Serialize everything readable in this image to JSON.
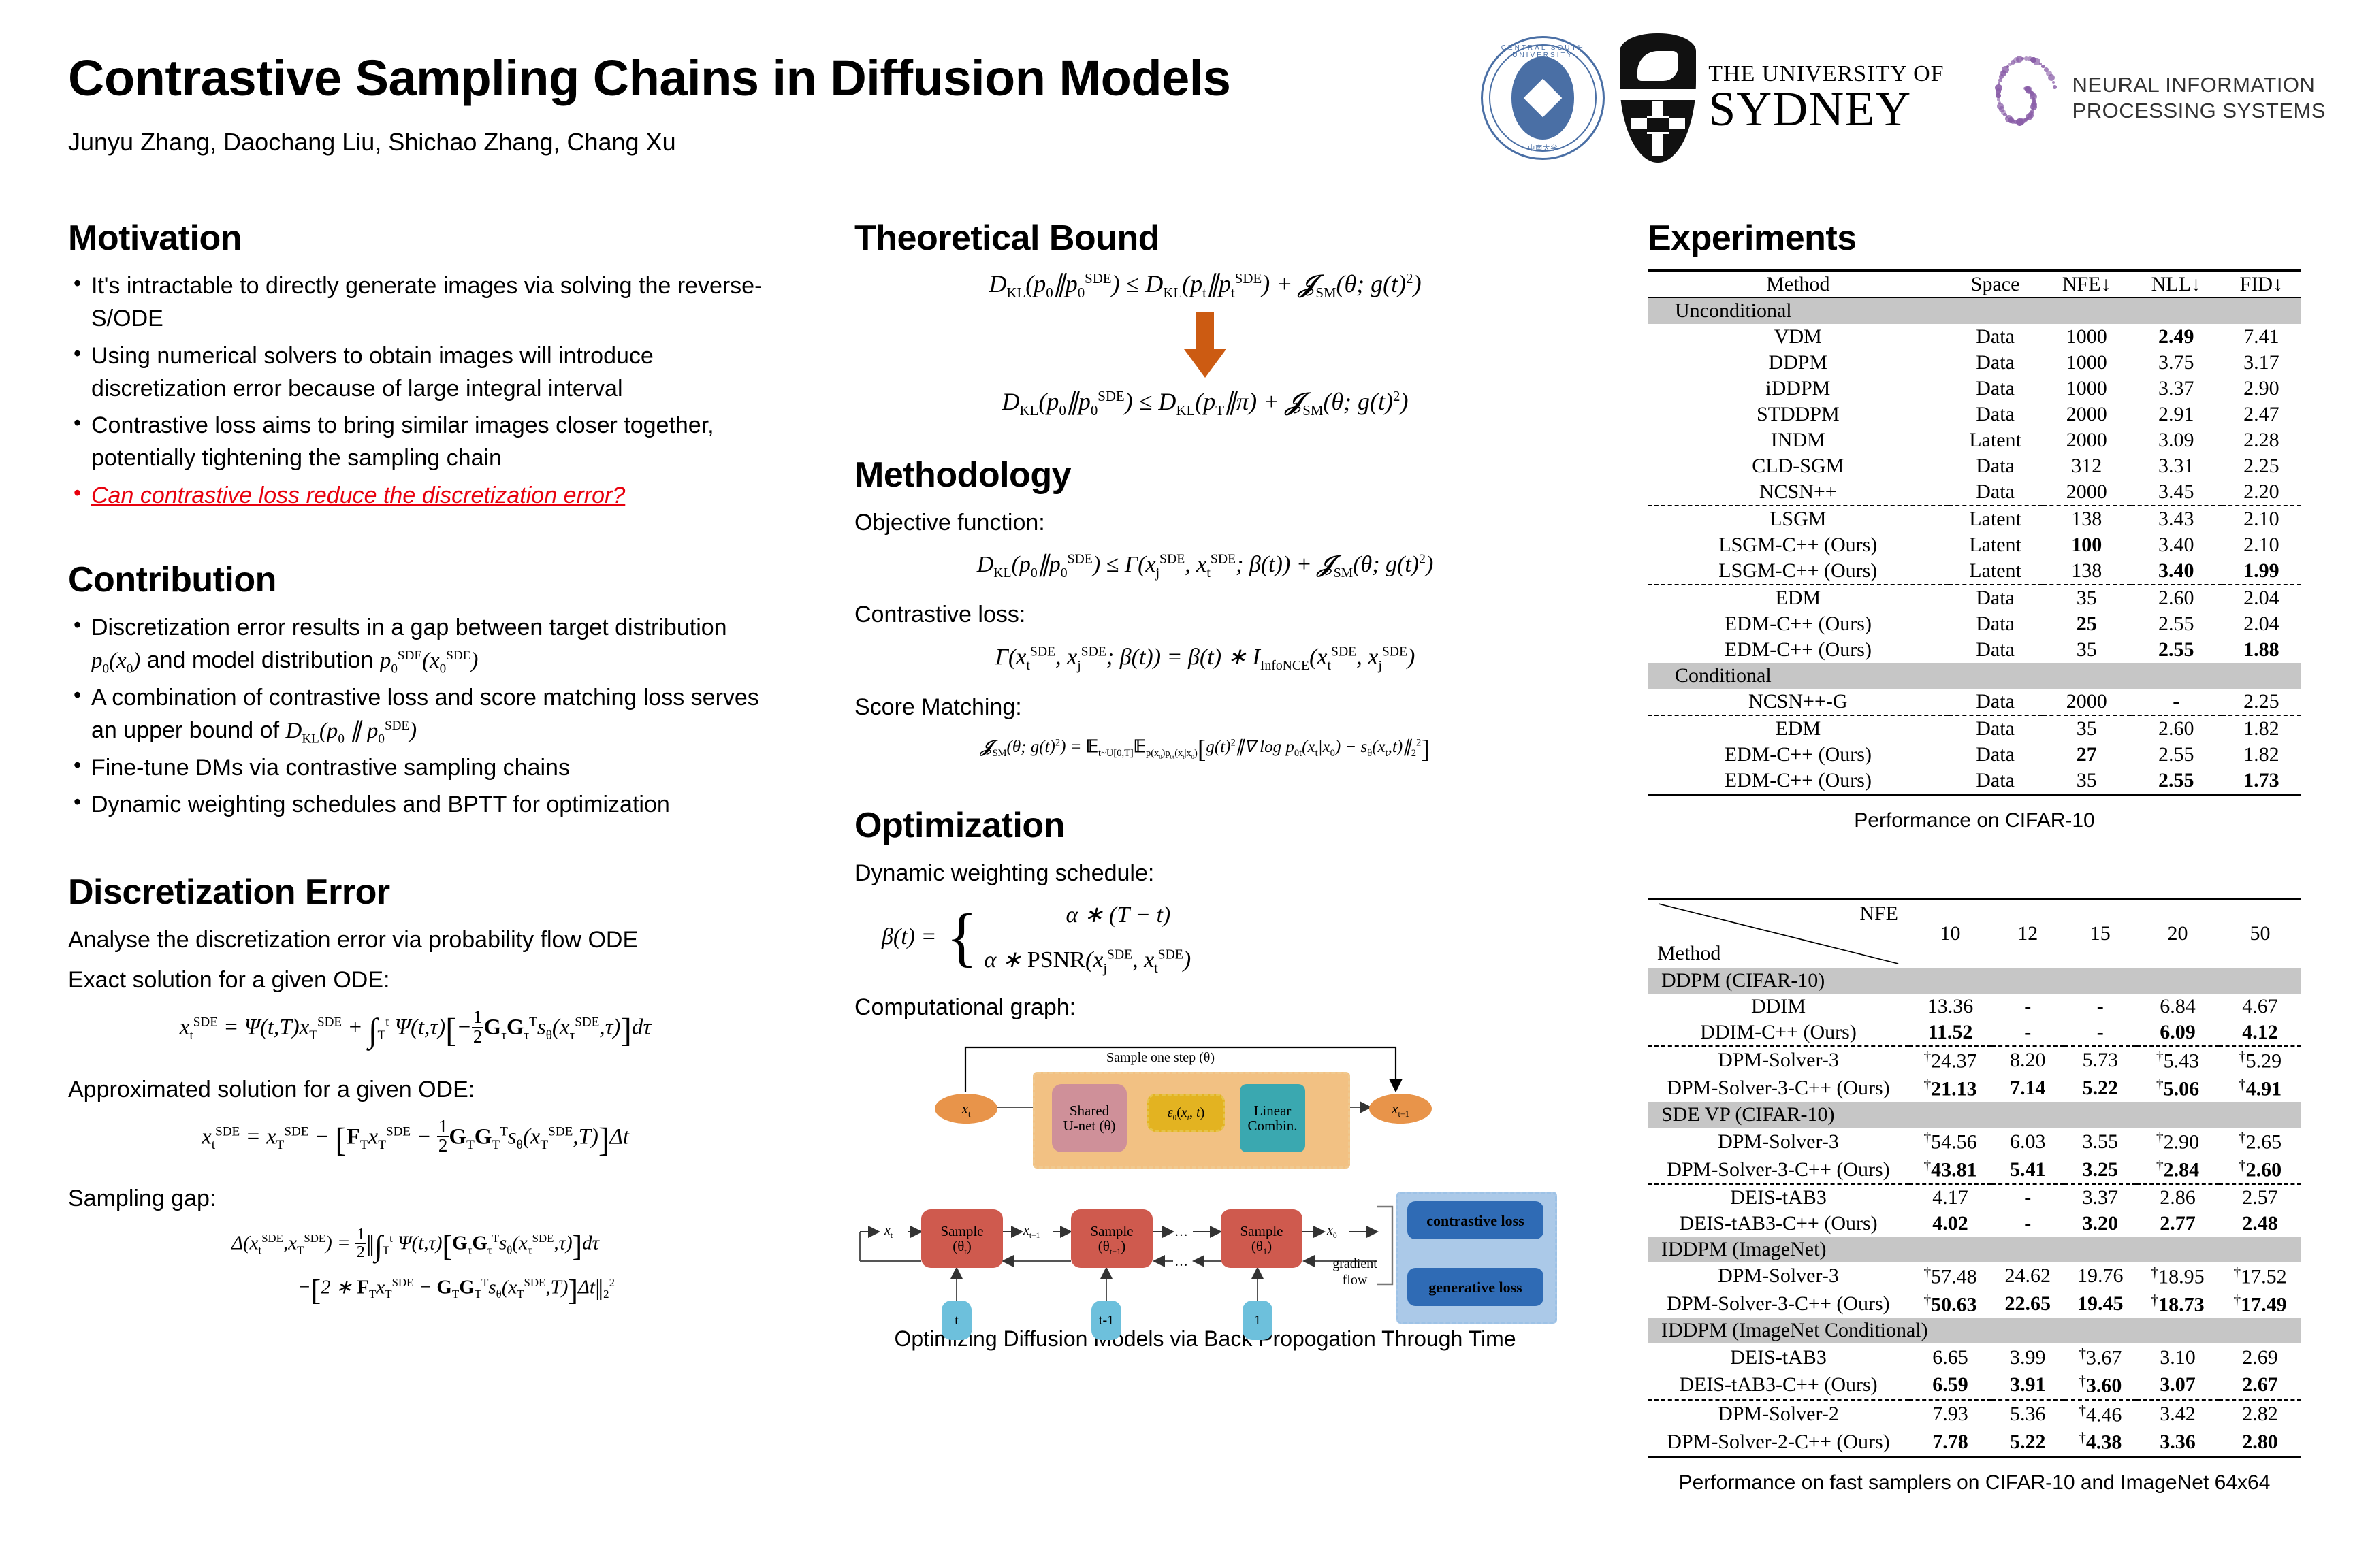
{
  "header": {
    "title": "Contrastive Sampling Chains in Diffusion Models",
    "authors": "Junyu Zhang, Daochang Liu, Shichao Zhang, Chang Xu",
    "logos": {
      "csu_top": "CENTRAL SOUTH UNIVERSITY",
      "csu_bottom": "中南大学",
      "sydney_line1": "THE UNIVERSITY OF",
      "sydney_line2": "SYDNEY",
      "neurips_line1": "NEURAL INFORMATION",
      "neurips_line2": "PROCESSING SYSTEMS"
    }
  },
  "motivation": {
    "heading": "Motivation",
    "bullets": [
      "It's intractable to directly generate images via solving the reverse-S/ODE",
      "Using numerical solvers to obtain images will introduce discretization error because of large integral interval",
      "Contrastive loss aims to bring similar images closer together, potentially tightening the sampling chain"
    ],
    "question": "Can contrastive loss reduce the discretization error?"
  },
  "contribution": {
    "heading": "Contribution",
    "b1_pre": "Discretization error results in a gap between target distribution ",
    "b1_mid": " and model distribution ",
    "b2_pre": "A combination of contrastive loss and score matching loss serves an upper bound of ",
    "b3": "Fine-tune DMs via contrastive sampling chains",
    "b4": "Dynamic weighting schedules and BPTT for optimization"
  },
  "discretization": {
    "heading": "Discretization Error",
    "line1": "Analyse the discretization error via probability flow ODE",
    "line2": "Exact solution for a given ODE:",
    "line3": "Approximated solution for a given ODE:",
    "line4": "Sampling gap:"
  },
  "theoretical": {
    "heading": "Theoretical Bound"
  },
  "methodology": {
    "heading": "Methodology",
    "objective_label": "Objective function:",
    "contrastive_label": "Contrastive loss:",
    "score_label": "Score Matching:"
  },
  "optimization": {
    "heading": "Optimization",
    "weight_label": "Dynamic weighting schedule:",
    "graph_label": "Computational graph:",
    "graph": {
      "sample_one_step": "Sample one step (θ)",
      "x_t": "x",
      "x_t_sub": "t",
      "shared_unet_l1": "Shared",
      "shared_unet_l2": "U-net (θ)",
      "eps": "ϵ",
      "eps_sub": "θ",
      "eps_args": "(x",
      "linear_l1": "Linear",
      "linear_l2": "Combin.",
      "x_tm1": "x",
      "x_tm1_sub": "t−1",
      "sample_l1": "Sample",
      "sample1_l2": "(θ",
      "sample1_sub": "t",
      "sample2_sub": "t−1",
      "sample3_sub": "1",
      "ellipsis": "…",
      "x_0": "x",
      "x_0_sub": "0",
      "t_box1": "t",
      "t_box2": "t-1",
      "t_box3": "1",
      "gradient_l1": "gradient",
      "gradient_l2": "flow",
      "contrastive_loss": "contrastive loss",
      "generative_loss": "generative loss"
    },
    "graph_caption": "Optimizing Diffusion Models via Back Propogation Through Time"
  },
  "experiments": {
    "heading": "Experiments",
    "table1": {
      "headers": [
        "Method",
        "Space",
        "NFE↓",
        "NLL↓",
        "FID↓"
      ],
      "rows": [
        {
          "type": "group",
          "label": "Unconditional"
        },
        {
          "type": "row",
          "cells": [
            "VDM",
            "Data",
            "1000",
            "2.49",
            "7.41"
          ],
          "bold": [
            false,
            false,
            false,
            true,
            false
          ]
        },
        {
          "type": "row",
          "cells": [
            "DDPM",
            "Data",
            "1000",
            "3.75",
            "3.17"
          ],
          "bold": [
            false,
            false,
            false,
            false,
            false
          ]
        },
        {
          "type": "row",
          "cells": [
            "iDDPM",
            "Data",
            "1000",
            "3.37",
            "2.90"
          ],
          "bold": [
            false,
            false,
            false,
            false,
            false
          ]
        },
        {
          "type": "row",
          "cells": [
            "STDDPM",
            "Data",
            "2000",
            "2.91",
            "2.47"
          ],
          "bold": [
            false,
            false,
            false,
            false,
            false
          ]
        },
        {
          "type": "row",
          "cells": [
            "INDM",
            "Latent",
            "2000",
            "3.09",
            "2.28"
          ],
          "bold": [
            false,
            false,
            false,
            false,
            false
          ]
        },
        {
          "type": "row",
          "cells": [
            "CLD-SGM",
            "Data",
            "312",
            "3.31",
            "2.25"
          ],
          "bold": [
            false,
            false,
            false,
            false,
            false
          ]
        },
        {
          "type": "row",
          "cells": [
            "NCSN++",
            "Data",
            "2000",
            "3.45",
            "2.20"
          ],
          "bold": [
            false,
            false,
            false,
            false,
            false
          ]
        },
        {
          "type": "row",
          "dashed": true,
          "cells": [
            "LSGM",
            "Latent",
            "138",
            "3.43",
            "2.10"
          ],
          "bold": [
            false,
            false,
            false,
            false,
            false
          ]
        },
        {
          "type": "row",
          "cells": [
            "LSGM-C++ (Ours)",
            "Latent",
            "100",
            "3.40",
            "2.10"
          ],
          "bold": [
            false,
            false,
            true,
            false,
            false
          ]
        },
        {
          "type": "row",
          "cells": [
            "LSGM-C++ (Ours)",
            "Latent",
            "138",
            "3.40",
            "1.99"
          ],
          "bold": [
            false,
            false,
            false,
            true,
            true
          ]
        },
        {
          "type": "row",
          "dashed": true,
          "cells": [
            "EDM",
            "Data",
            "35",
            "2.60",
            "2.04"
          ],
          "bold": [
            false,
            false,
            false,
            false,
            false
          ]
        },
        {
          "type": "row",
          "cells": [
            "EDM-C++ (Ours)",
            "Data",
            "25",
            "2.55",
            "2.04"
          ],
          "bold": [
            false,
            false,
            true,
            false,
            false
          ]
        },
        {
          "type": "row",
          "cells": [
            "EDM-C++ (Ours)",
            "Data",
            "35",
            "2.55",
            "1.88"
          ],
          "bold": [
            false,
            false,
            false,
            true,
            true
          ]
        },
        {
          "type": "group",
          "label": "Conditional"
        },
        {
          "type": "row",
          "cells": [
            "NCSN++-G",
            "Data",
            "2000",
            "-",
            "2.25"
          ],
          "bold": [
            false,
            false,
            false,
            false,
            false
          ]
        },
        {
          "type": "row",
          "dashed": true,
          "cells": [
            "EDM",
            "Data",
            "35",
            "2.60",
            "1.82"
          ],
          "bold": [
            false,
            false,
            false,
            false,
            false
          ]
        },
        {
          "type": "row",
          "cells": [
            "EDM-C++ (Ours)",
            "Data",
            "27",
            "2.55",
            "1.82"
          ],
          "bold": [
            false,
            false,
            true,
            false,
            false
          ]
        },
        {
          "type": "row",
          "cells": [
            "EDM-C++ (Ours)",
            "Data",
            "35",
            "2.55",
            "1.73"
          ],
          "bold": [
            false,
            false,
            false,
            true,
            true
          ]
        }
      ],
      "caption": "Performance on CIFAR-10"
    },
    "table2": {
      "corner_top": "NFE",
      "corner_bottom": "Method",
      "nfe_columns": [
        "10",
        "12",
        "15",
        "20",
        "50"
      ],
      "rows": [
        {
          "type": "group",
          "label": "DDPM (CIFAR-10)"
        },
        {
          "type": "row",
          "method": "DDIM",
          "cells": [
            "13.36",
            "-",
            "-",
            "6.84",
            "4.67"
          ],
          "dag": [
            false,
            false,
            false,
            false,
            false
          ],
          "bold": false
        },
        {
          "type": "row",
          "method": "DDIM-C++ (Ours)",
          "cells": [
            "11.52",
            "-",
            "-",
            "6.09",
            "4.12"
          ],
          "dag": [
            false,
            false,
            false,
            false,
            false
          ],
          "bold": true
        },
        {
          "type": "row",
          "dashed": true,
          "method": "DPM-Solver-3",
          "cells": [
            "24.37",
            "8.20",
            "5.73",
            "5.43",
            "5.29"
          ],
          "dag": [
            true,
            false,
            false,
            true,
            true
          ],
          "bold": false
        },
        {
          "type": "row",
          "method": "DPM-Solver-3-C++ (Ours)",
          "cells": [
            "21.13",
            "7.14",
            "5.22",
            "5.06",
            "4.91"
          ],
          "dag": [
            true,
            false,
            false,
            true,
            true
          ],
          "bold": true
        },
        {
          "type": "group",
          "label": "SDE VP (CIFAR-10)"
        },
        {
          "type": "row",
          "method": "DPM-Solver-3",
          "cells": [
            "54.56",
            "6.03",
            "3.55",
            "2.90",
            "2.65"
          ],
          "dag": [
            true,
            false,
            false,
            true,
            true
          ],
          "bold": false
        },
        {
          "type": "row",
          "method": "DPM-Solver-3-C++ (Ours)",
          "cells": [
            "43.81",
            "5.41",
            "3.25",
            "2.84",
            "2.60"
          ],
          "dag": [
            true,
            false,
            false,
            true,
            true
          ],
          "bold": true
        },
        {
          "type": "row",
          "dashed": true,
          "method": "DEIS-tAB3",
          "cells": [
            "4.17",
            "-",
            "3.37",
            "2.86",
            "2.57"
          ],
          "dag": [
            false,
            false,
            false,
            false,
            false
          ],
          "bold": false
        },
        {
          "type": "row",
          "method": "DEIS-tAB3-C++ (Ours)",
          "cells": [
            "4.02",
            "-",
            "3.20",
            "2.77",
            "2.48"
          ],
          "dag": [
            false,
            false,
            false,
            false,
            false
          ],
          "bold": true
        },
        {
          "type": "group",
          "label": "IDDPM (ImageNet)"
        },
        {
          "type": "row",
          "method": "DPM-Solver-3",
          "cells": [
            "57.48",
            "24.62",
            "19.76",
            "18.95",
            "17.52"
          ],
          "dag": [
            true,
            false,
            false,
            true,
            true
          ],
          "bold": false
        },
        {
          "type": "row",
          "method": "DPM-Solver-3-C++ (Ours)",
          "cells": [
            "50.63",
            "22.65",
            "19.45",
            "18.73",
            "17.49"
          ],
          "dag": [
            true,
            false,
            false,
            true,
            true
          ],
          "bold": true
        },
        {
          "type": "group",
          "label": "IDDPM (ImageNet Conditional)"
        },
        {
          "type": "row",
          "method": "DEIS-tAB3",
          "cells": [
            "6.65",
            "3.99",
            "3.67",
            "3.10",
            "2.69"
          ],
          "dag": [
            false,
            false,
            true,
            false,
            false
          ],
          "bold": false
        },
        {
          "type": "row",
          "method": "DEIS-tAB3-C++ (Ours)",
          "cells": [
            "6.59",
            "3.91",
            "3.60",
            "3.07",
            "2.67"
          ],
          "dag": [
            false,
            false,
            true,
            false,
            false
          ],
          "bold": true
        },
        {
          "type": "row",
          "dashed": true,
          "method": "DPM-Solver-2",
          "cells": [
            "7.93",
            "5.36",
            "4.46",
            "3.42",
            "2.82"
          ],
          "dag": [
            false,
            false,
            true,
            false,
            false
          ],
          "bold": false
        },
        {
          "type": "row",
          "method": "DPM-Solver-2-C++ (Ours)",
          "cells": [
            "7.78",
            "5.22",
            "4.38",
            "3.36",
            "2.80"
          ],
          "dag": [
            false,
            false,
            true,
            false,
            false
          ],
          "bold": true
        }
      ],
      "caption": "Performance on fast samplers on CIFAR-10 and ImageNet 64x64"
    }
  },
  "colors": {
    "accent_red": "#e8000d",
    "arrow_orange": "#cc5b12",
    "group_gray": "#c6c6c6",
    "neurips_purple": "#8a5ea8",
    "csu_blue": "#4a6fa5"
  }
}
